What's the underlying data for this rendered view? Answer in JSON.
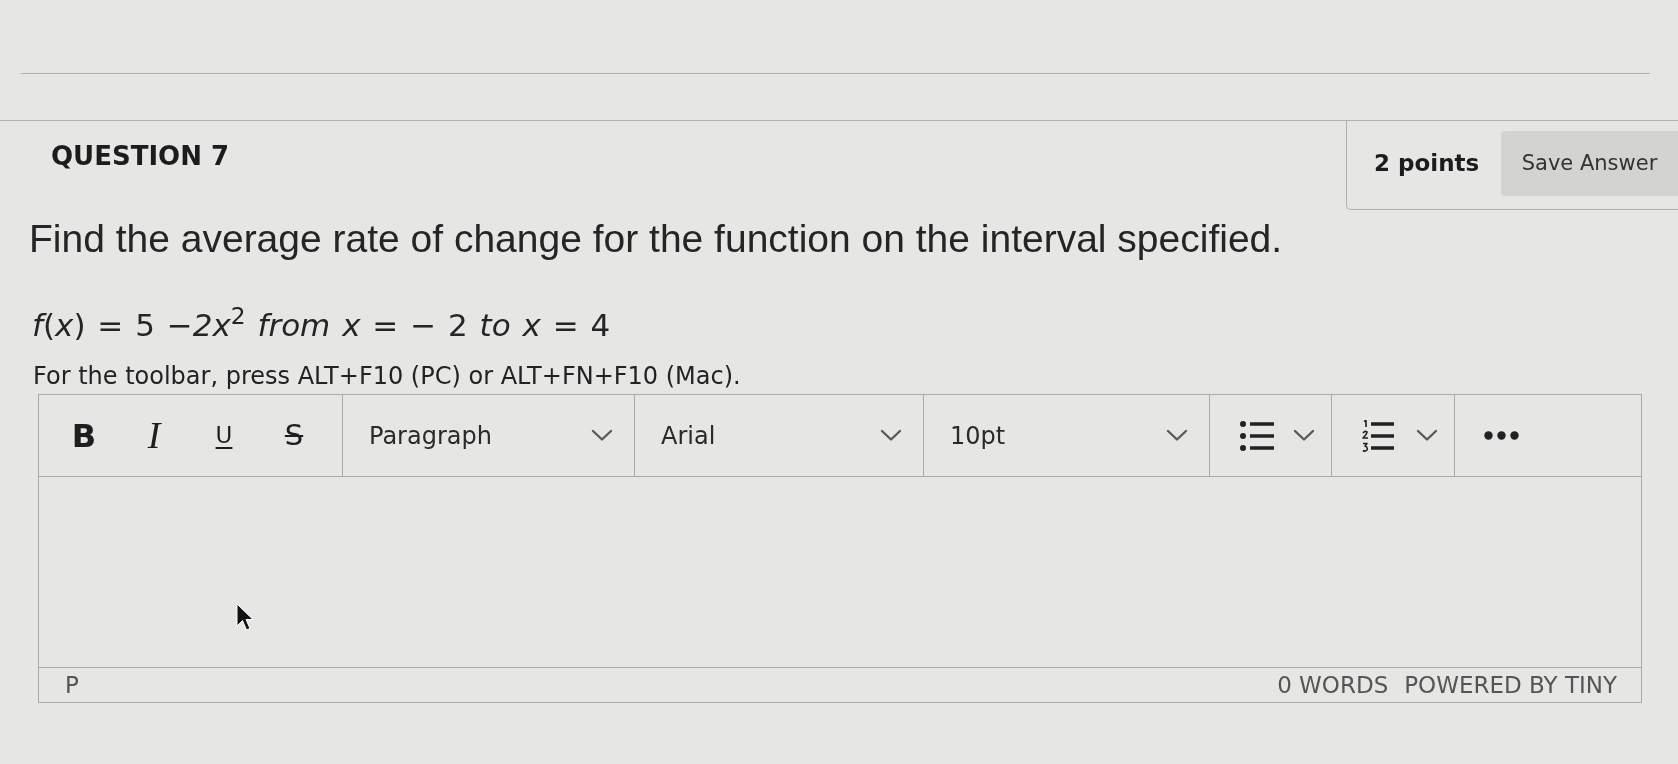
{
  "question": {
    "title": "QUESTION 7",
    "points": "2 points",
    "save_button": "Save Answer",
    "prompt": "Find the average rate of change for the function on the interval specified.",
    "formula": "*f*(*x*) = 5 −*2x*$^{2}$ *from x* = − 2 *to x* = 4",
    "instruction": "For the toolbar, press ALT+F10 (PC) or ALT+FN+F10 (Mac)."
  },
  "editor": {
    "toolbar": [
      {
        "kind": "bold",
        "label": "B"
      },
      {
        "kind": "italic",
        "label": "I"
      },
      {
        "kind": "underline",
        "label": "U"
      },
      {
        "kind": "strikethrough",
        "label": "S"
      },
      {
        "kind": "block-format",
        "value": "Paragraph"
      },
      {
        "kind": "font-family",
        "value": "Arial"
      },
      {
        "kind": "font-size",
        "value": "10pt"
      },
      {
        "kind": "bullet-list"
      },
      {
        "kind": "numbered-list"
      },
      {
        "kind": "more"
      }
    ],
    "status_bar": {
      "path": "P",
      "word_count": "0 WORDS",
      "branding": "POWERED BY TINY"
    }
  }
}
